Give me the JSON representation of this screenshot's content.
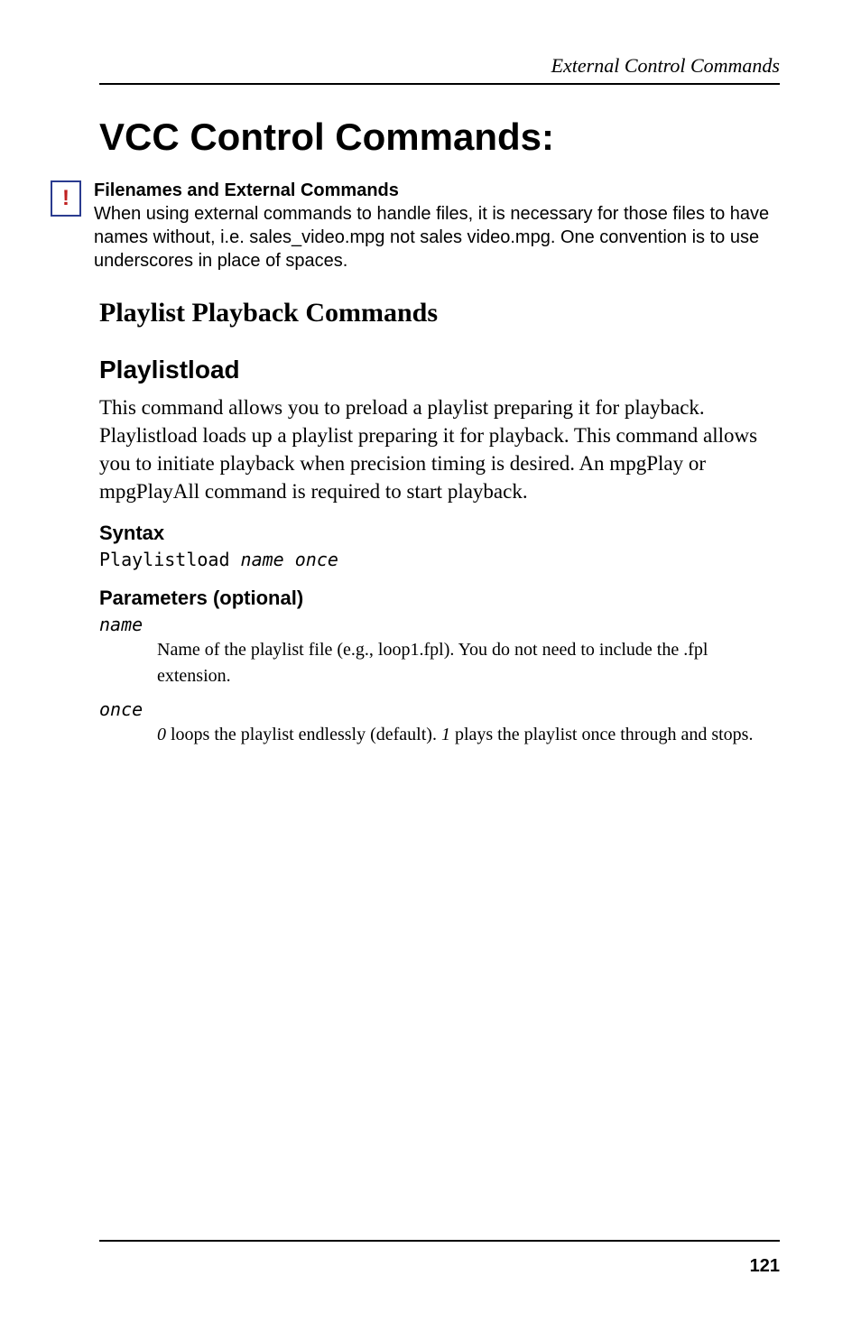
{
  "running_head": "External Control Commands",
  "title": "VCC Control Commands:",
  "note": {
    "icon_glyph": "!",
    "heading": "Filenames and External Commands",
    "body": "When using external commands to handle files, it is necessary for those files to have names without, i.e. sales_video.mpg not sales video.mpg. One convention is to use underscores in place of spaces."
  },
  "section_h2": "Playlist Playback Commands",
  "command": {
    "name": "Playlistload",
    "description": "This command allows you to preload a playlist preparing it for playback. Playlistload loads up a playlist preparing it for playback. This command allows you to initiate playback when precision timing is desired. An mpgPlay or mpgPlayAll command is required to start playback.",
    "syntax_label": "Syntax",
    "syntax_keyword": "Playlistload",
    "syntax_params": "name once",
    "params_label": "Parameters (optional)",
    "params": [
      {
        "name": "name",
        "desc_plain": "Name of the playlist file (e.g., loop1.fpl). You do not need to include the .fpl extension."
      },
      {
        "name": "once",
        "desc_pre": "",
        "ital1": "0",
        "mid1": " loops the playlist endlessly (default). ",
        "ital2": "1",
        "mid2": " plays the playlist once through and stops."
      }
    ]
  },
  "page_number": "121"
}
